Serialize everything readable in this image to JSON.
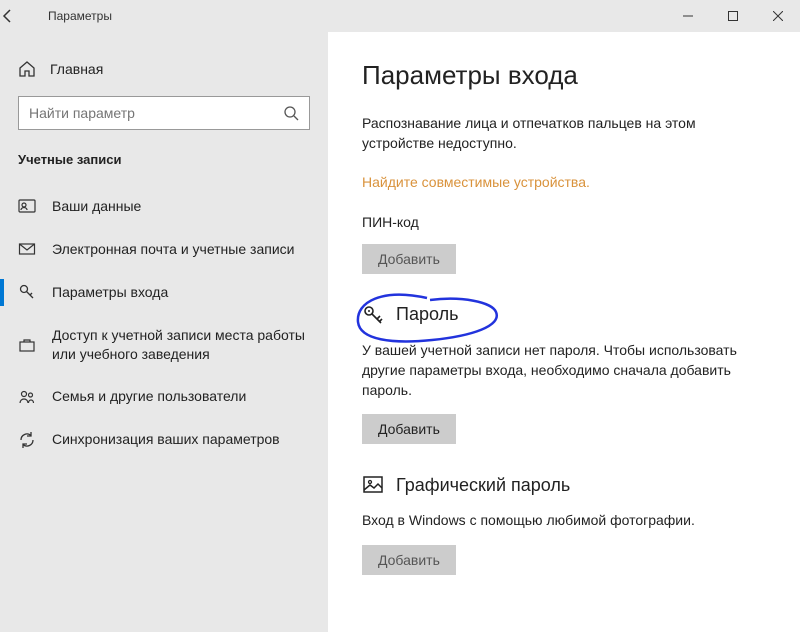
{
  "titlebar": {
    "title": "Параметры"
  },
  "sidebar": {
    "home_label": "Главная",
    "search_placeholder": "Найти параметр",
    "section_title": "Учетные записи",
    "items": [
      {
        "label": "Ваши данные"
      },
      {
        "label": "Электронная почта и учетные записи"
      },
      {
        "label": "Параметры входа"
      },
      {
        "label": "Доступ к учетной записи места работы или учебного заведения"
      },
      {
        "label": "Семья и другие пользователи"
      },
      {
        "label": "Синхронизация ваших параметров"
      }
    ]
  },
  "main": {
    "page_title": "Параметры входа",
    "desc": "Распознавание лица и отпечатков пальцев на этом устройстве недоступно.",
    "link": "Найдите совместимые устройства.",
    "pin": {
      "title": "ПИН-код",
      "button": "Добавить"
    },
    "password": {
      "title": "Пароль",
      "desc": "У вашей учетной записи нет пароля. Чтобы использовать другие параметры входа, необходимо сначала добавить пароль.",
      "button": "Добавить"
    },
    "picture": {
      "title": "Графический пароль",
      "desc": "Вход в Windows с помощью любимой фотографии.",
      "button": "Добавить"
    }
  }
}
